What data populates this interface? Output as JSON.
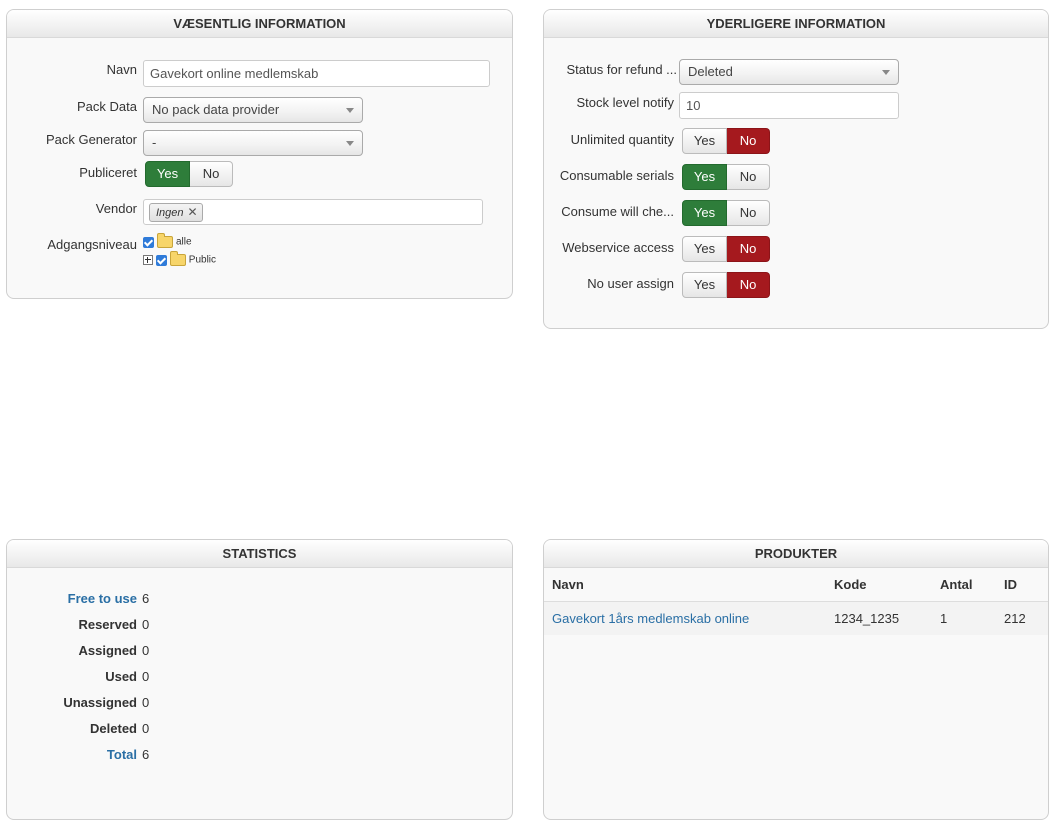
{
  "essential": {
    "title": "VÆSENTLIG INFORMATION",
    "name_label": "Navn",
    "name_value": "Gavekort online medlemskab",
    "pack_data_label": "Pack Data",
    "pack_data_value": "No pack data provider",
    "pack_generator_label": "Pack Generator",
    "pack_generator_value": "-",
    "published_label": "Publiceret",
    "published": {
      "yes": "Yes",
      "no": "No",
      "selected": "Yes"
    },
    "vendor_label": "Vendor",
    "vendor_chip": "Ingen",
    "access_label": "Adgangsniveau",
    "access_tree": [
      {
        "label": "alle",
        "checked": true
      },
      {
        "label": "Public",
        "checked": true
      }
    ]
  },
  "additional": {
    "title": "YDERLIGERE INFORMATION",
    "refund_status_label": "Status for refund ...",
    "refund_status_value": "Deleted",
    "stock_label": "Stock level notify",
    "stock_value": "10",
    "toggles": [
      {
        "label": "Unlimited quantity",
        "yes": "Yes",
        "no": "No",
        "selected": "No"
      },
      {
        "label": "Consumable serials",
        "yes": "Yes",
        "no": "No",
        "selected": "Yes"
      },
      {
        "label": "Consume will che...",
        "yes": "Yes",
        "no": "No",
        "selected": "Yes"
      },
      {
        "label": "Webservice access",
        "yes": "Yes",
        "no": "No",
        "selected": "No"
      },
      {
        "label": "No user assign",
        "yes": "Yes",
        "no": "No",
        "selected": "No"
      }
    ]
  },
  "statistics": {
    "title": "STATISTICS",
    "rows": [
      {
        "label": "Free to use",
        "value": "6",
        "link": true
      },
      {
        "label": "Reserved",
        "value": "0",
        "link": false
      },
      {
        "label": "Assigned",
        "value": "0",
        "link": false
      },
      {
        "label": "Used",
        "value": "0",
        "link": false
      },
      {
        "label": "Unassigned",
        "value": "0",
        "link": false
      },
      {
        "label": "Deleted",
        "value": "0",
        "link": false
      },
      {
        "label": "Total",
        "value": "6",
        "link": true
      }
    ]
  },
  "products": {
    "title": "PRODUKTER",
    "columns": [
      "Navn",
      "Kode",
      "Antal",
      "ID"
    ],
    "rows": [
      {
        "name": "Gavekort 1års medlemskab online",
        "code": "1234_1235",
        "qty": "1",
        "id": "212"
      }
    ]
  },
  "colors": {
    "yes_on": "#2e7d3a",
    "no_on": "#a5191e",
    "link": "#2a6fa5"
  }
}
